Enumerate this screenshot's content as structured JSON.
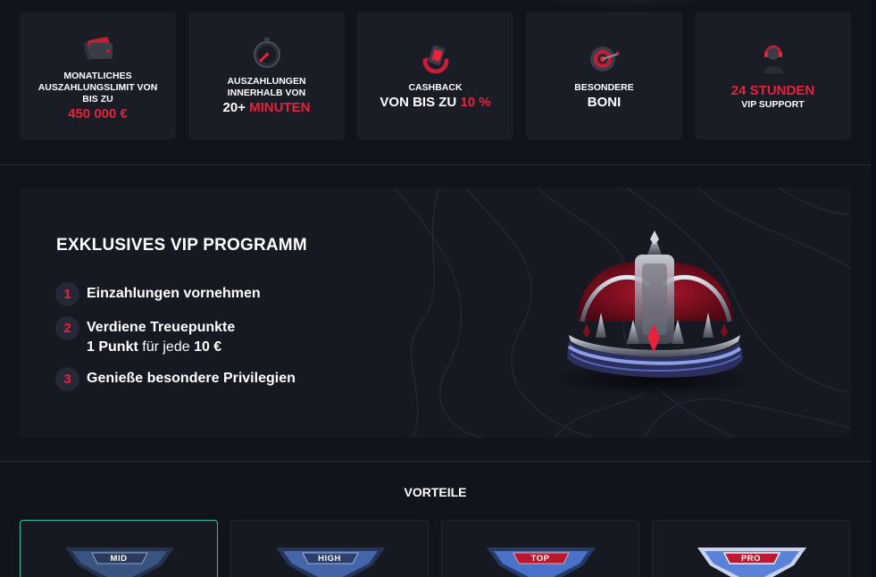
{
  "features": [
    {
      "icon": "wallet-icon",
      "small": [
        "Monatliches",
        "Auszahlungslimit von",
        "bis zu"
      ],
      "big_white": "",
      "big_red": "450 000 €"
    },
    {
      "icon": "stopwatch-icon",
      "small": [
        "Auszahlungen",
        "innerhalb von"
      ],
      "big_white": "20+",
      "big_red": "Minuten"
    },
    {
      "icon": "cashback-icon",
      "small": [
        "Cashback"
      ],
      "big_white": "von bis zu",
      "big_red": "10 %"
    },
    {
      "icon": "target-icon",
      "small": [
        "Besondere"
      ],
      "big_white": "Boni",
      "big_red": ""
    },
    {
      "icon": "support-agent-icon",
      "top_red": "24 Stunden",
      "small": [
        "VIP Support"
      ]
    }
  ],
  "vip": {
    "title": "Exklusives VIP Programm",
    "steps": [
      {
        "num": "1",
        "line1": "Einzahlungen vornehmen",
        "line2_bold": "",
        "line2_normal": "",
        "line2_tail": ""
      },
      {
        "num": "2",
        "line1": "Verdiene Treuepunkte",
        "line2_bold": "1 Punkt",
        "line2_normal": " für jede ",
        "line2_tail": "10 €"
      },
      {
        "num": "3",
        "line1": "Genieße besondere Privilegien",
        "line2_bold": "",
        "line2_normal": "",
        "line2_tail": ""
      }
    ]
  },
  "vorteile": {
    "title": "Vorteile",
    "tiers": [
      "MID",
      "HIGH",
      "TOP",
      "PRO"
    ],
    "active_index": 0
  },
  "colors": {
    "accent_red": "#e8213c",
    "active_border": "#2ec4a9",
    "card_bg": "#1a1c26",
    "page_bg": "#12141d"
  }
}
